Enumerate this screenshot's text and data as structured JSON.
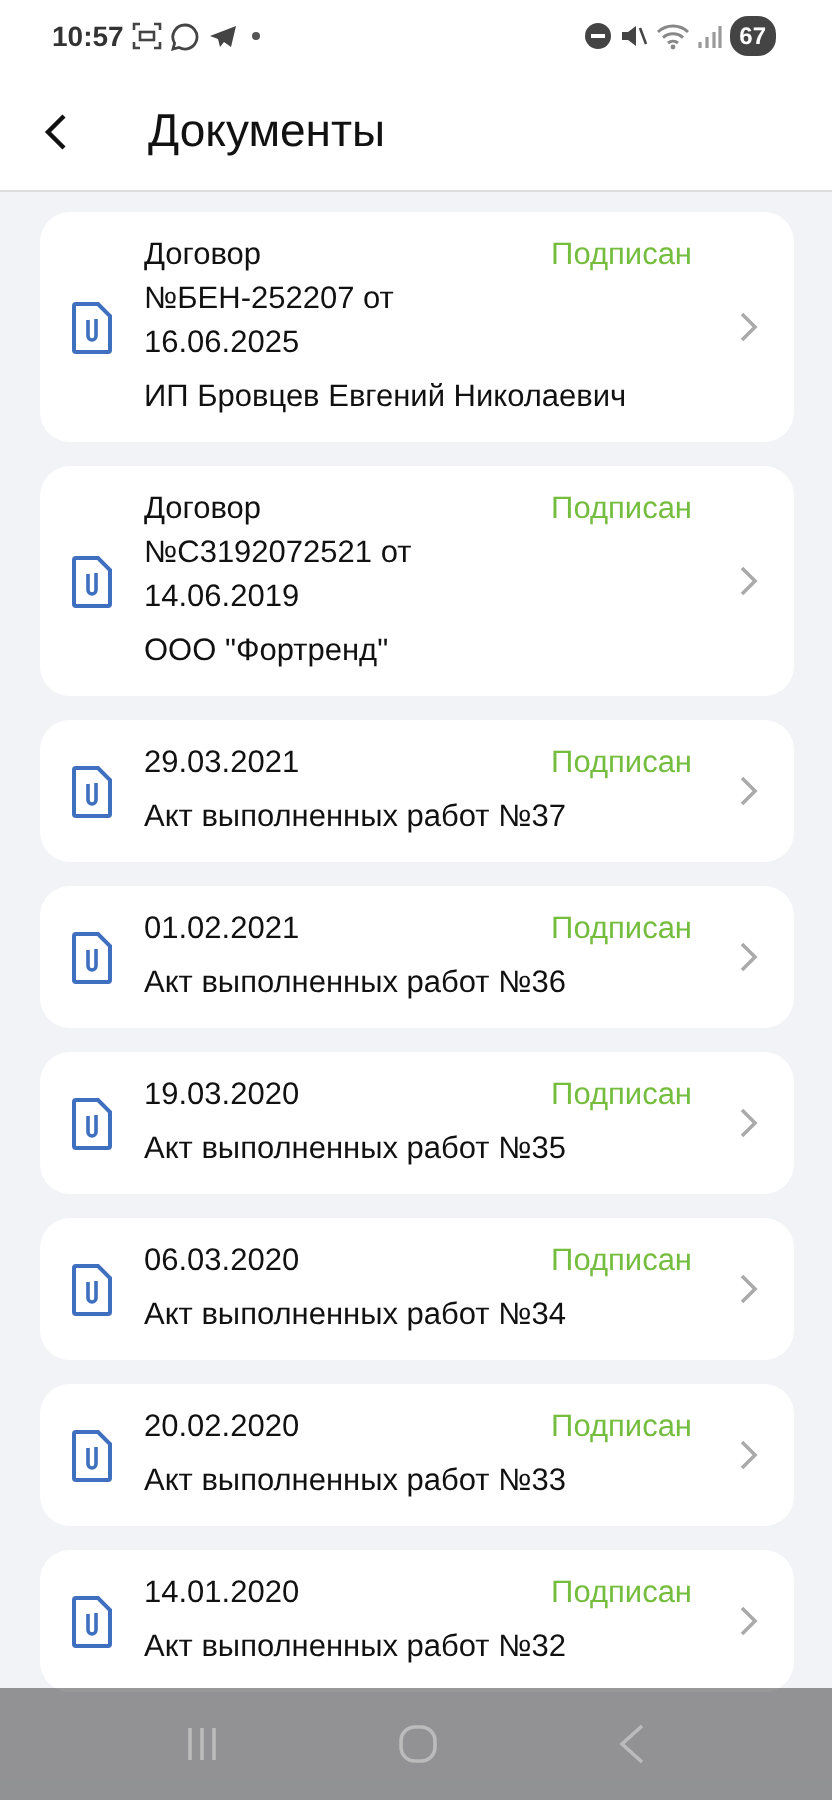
{
  "status_bar": {
    "time": "10:57",
    "battery": "67"
  },
  "header": {
    "title": "Документы"
  },
  "documents": [
    {
      "title": "Договор №БЕН-252207 от 16.06.2025",
      "status": "Подписан",
      "subtitle": "ИП Бровцев Евгений Николаевич"
    },
    {
      "title": "Договор №С3192072521 от 14.06.2019",
      "status": "Подписан",
      "subtitle": "ООО \"Фортренд\""
    },
    {
      "title": "29.03.2021",
      "status": "Подписан",
      "subtitle": "Акт выполненных работ №37"
    },
    {
      "title": "01.02.2021",
      "status": "Подписан",
      "subtitle": "Акт выполненных работ №36"
    },
    {
      "title": "19.03.2020",
      "status": "Подписан",
      "subtitle": "Акт выполненных работ №35"
    },
    {
      "title": "06.03.2020",
      "status": "Подписан",
      "subtitle": "Акт выполненных работ №34"
    },
    {
      "title": "20.02.2020",
      "status": "Подписан",
      "subtitle": "Акт выполненных работ №33"
    },
    {
      "title": "14.01.2020",
      "status": "Подписан",
      "subtitle": "Акт выполненных работ №32"
    }
  ]
}
